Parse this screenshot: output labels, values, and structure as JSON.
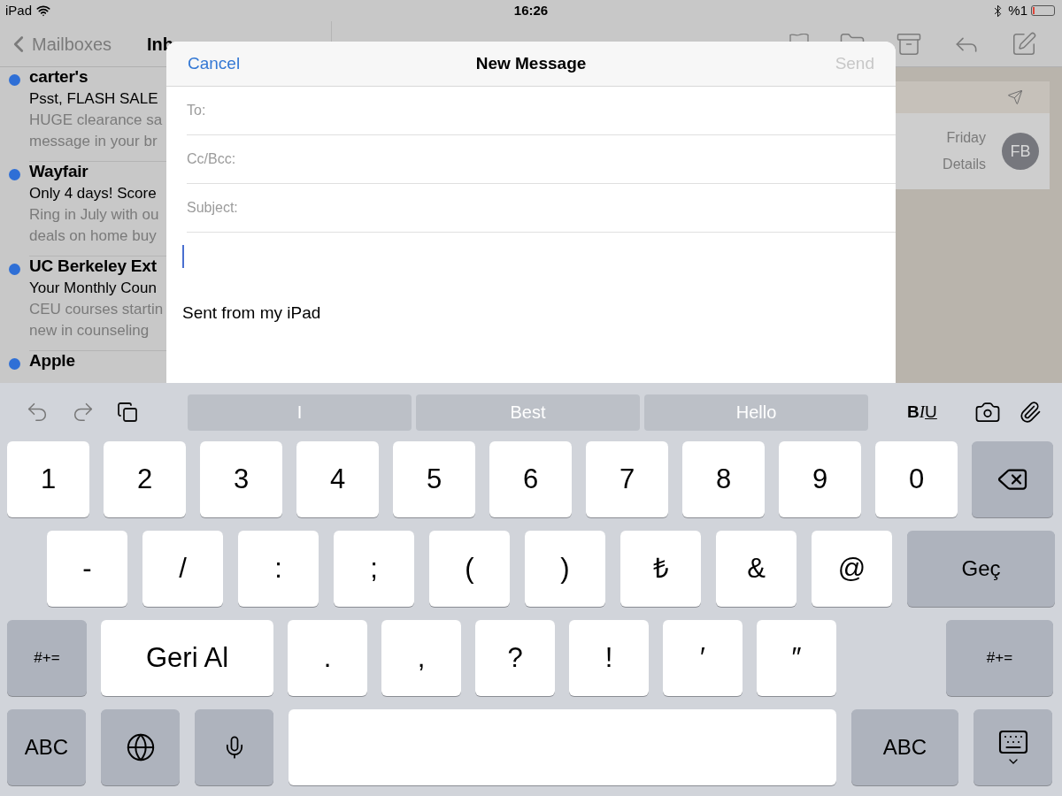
{
  "status_bar": {
    "device": "iPad",
    "time": "16:26",
    "battery_text": "%1"
  },
  "mailbox_nav": {
    "back": "Mailboxes",
    "title": "Inb"
  },
  "messages": [
    {
      "sender": "carter's",
      "subject": "Psst, FLASH SALE",
      "preview": [
        "HUGE clearance sa",
        "message in your br"
      ],
      "unread": true
    },
    {
      "sender": "Wayfair",
      "subject": "Only 4 days! Score",
      "preview": [
        "Ring in July with ou",
        "deals on home buy"
      ],
      "unread": true
    },
    {
      "sender": "UC Berkeley Ext",
      "subject": "Your Monthly Coun",
      "preview": [
        "CEU courses startin",
        "new in counseling"
      ],
      "unread": true
    },
    {
      "sender": "Apple",
      "unread": true
    }
  ],
  "detail": {
    "date": "Friday",
    "details_link": "Details",
    "avatar_initials": "FB"
  },
  "compose": {
    "cancel": "Cancel",
    "title": "New Message",
    "send": "Send",
    "send_disabled": true,
    "fields": [
      {
        "label": "To:"
      },
      {
        "label": "Cc/Bcc:"
      },
      {
        "label": "Subject:"
      }
    ],
    "signature": "Sent from my iPad"
  },
  "keyboard": {
    "suggestions": [
      {
        "text": "I"
      },
      {
        "text": "Best"
      },
      {
        "text": "Hello"
      }
    ],
    "format_labels": [
      "B",
      "I",
      "U"
    ],
    "rows": [
      [
        {
          "kind": "char",
          "label": "1"
        },
        {
          "kind": "char",
          "label": "2"
        },
        {
          "kind": "char",
          "label": "3"
        },
        {
          "kind": "char",
          "label": "4"
        },
        {
          "kind": "char",
          "label": "5"
        },
        {
          "kind": "char",
          "label": "6"
        },
        {
          "kind": "char",
          "label": "7"
        },
        {
          "kind": "char",
          "label": "8"
        },
        {
          "kind": "char",
          "label": "9"
        },
        {
          "kind": "char",
          "label": "0"
        },
        {
          "kind": "delete"
        }
      ],
      [
        {
          "kind": "char",
          "label": "-"
        },
        {
          "kind": "char",
          "label": "/"
        },
        {
          "kind": "char",
          "label": ":"
        },
        {
          "kind": "char",
          "label": ";"
        },
        {
          "kind": "char",
          "label": "("
        },
        {
          "kind": "char",
          "label": ")"
        },
        {
          "kind": "char",
          "label": "₺"
        },
        {
          "kind": "char",
          "label": "&"
        },
        {
          "kind": "char",
          "label": "@"
        },
        {
          "kind": "action",
          "label": "Geç"
        }
      ],
      [
        {
          "kind": "action",
          "label": "#+="
        },
        {
          "kind": "char",
          "label": "Geri Al"
        },
        {
          "kind": "char",
          "label": "."
        },
        {
          "kind": "char",
          "label": ","
        },
        {
          "kind": "char",
          "label": "?"
        },
        {
          "kind": "char",
          "label": "!"
        },
        {
          "kind": "char",
          "label": "′"
        },
        {
          "kind": "char",
          "label": "″"
        },
        {
          "kind": "action",
          "label": "#+="
        }
      ],
      [
        {
          "kind": "action",
          "label": "ABC"
        },
        {
          "kind": "globe"
        },
        {
          "kind": "mic"
        },
        {
          "kind": "space"
        },
        {
          "kind": "action",
          "label": "ABC"
        },
        {
          "kind": "dismiss"
        }
      ]
    ]
  }
}
